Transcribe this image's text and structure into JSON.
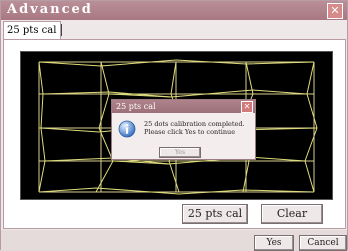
{
  "window": {
    "title": "Advanced",
    "close_glyph": "✕"
  },
  "tabs": [
    {
      "label": "25 pts cal",
      "selected": true
    }
  ],
  "canvas": {
    "background": "#000000",
    "grid_color": "#d8d08a",
    "line_color": "#dcd87a"
  },
  "buttons": {
    "cal": "25 pts cal",
    "clear": "Clear",
    "yes": "Yes",
    "cancel": "Cancel"
  },
  "dialog": {
    "title": "25 pts cal",
    "close_glyph": "✕",
    "icon": "info-icon",
    "message_line1": "25 dots calibration completed.",
    "message_line2": "Please click Yes to continue",
    "yes_label": "Yes"
  }
}
